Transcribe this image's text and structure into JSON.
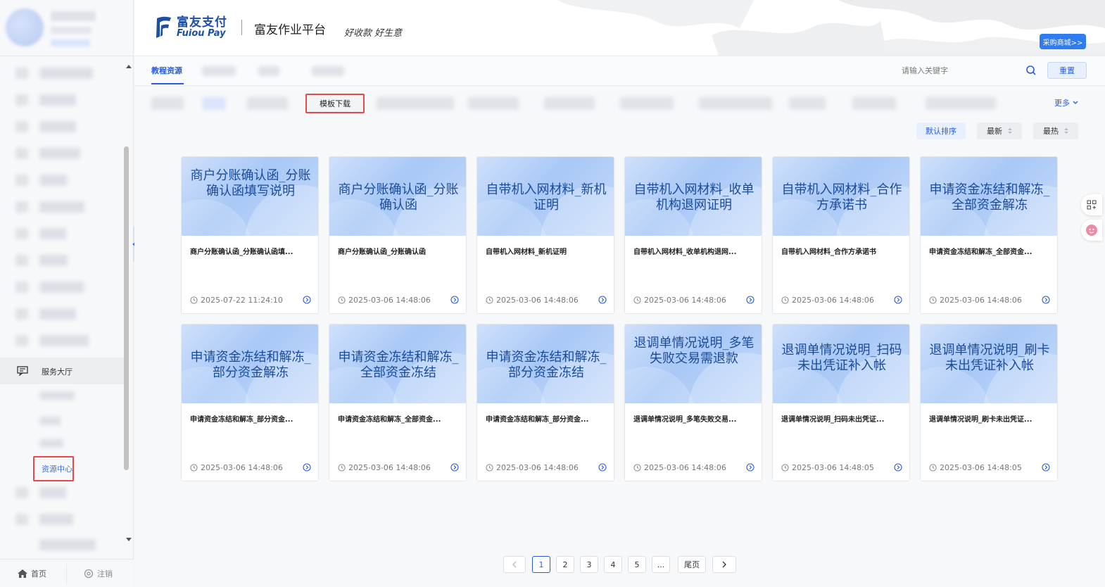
{
  "header": {
    "logo_cn": "富友支付",
    "logo_en": "Fuiou Pay",
    "title": "富友作业平台",
    "slogan": "好收款 好生意",
    "mall_button": "采购商城>>"
  },
  "sidebar": {
    "active_group_label": "服务大厅",
    "active_item_label": "资源中心",
    "bottom": {
      "home_label": "首页",
      "logout_label": "注销"
    }
  },
  "main": {
    "active_tab": "教程资源",
    "search": {
      "placeholder": "请输入关键字"
    },
    "reset_label": "重置",
    "highlight_category": "模板下载",
    "more_label": "更多",
    "sort": {
      "default": "默认排序",
      "newest": "最新",
      "hottest": "最热"
    }
  },
  "cards": [
    {
      "thumb": "商户分账确认函_分账确认函填写说明",
      "title": "商户分账确认函_分账确认函填...",
      "time": "2025-07-22 11:24:10"
    },
    {
      "thumb": "商户分账确认函_分账确认函",
      "title": "商户分账确认函_分账确认函",
      "time": "2025-03-06 14:48:06"
    },
    {
      "thumb": "自带机入网材料_新机证明",
      "title": "自带机入网材料_新机证明",
      "time": "2025-03-06 14:48:06"
    },
    {
      "thumb": "自带机入网材料_收单机构退网证明",
      "title": "自带机入网材料_收单机构退网...",
      "time": "2025-03-06 14:48:06"
    },
    {
      "thumb": "自带机入网材料_合作方承诺书",
      "title": "自带机入网材料_合作方承诺书",
      "time": "2025-03-06 14:48:06"
    },
    {
      "thumb": "申请资金冻结和解冻_全部资金解冻",
      "title": "申请资金冻结和解冻_全部资金...",
      "time": "2025-03-06 14:48:06"
    },
    {
      "thumb": "申请资金冻结和解冻_部分资金解冻",
      "title": "申请资金冻结和解冻_部分资金...",
      "time": "2025-03-06 14:48:06"
    },
    {
      "thumb": "申请资金冻结和解冻_全部资金冻结",
      "title": "申请资金冻结和解冻_全部资金...",
      "time": "2025-03-06 14:48:06"
    },
    {
      "thumb": "申请资金冻结和解冻_部分资金冻结",
      "title": "申请资金冻结和解冻_部分资金...",
      "time": "2025-03-06 14:48:06"
    },
    {
      "thumb": "退调单情况说明_多笔失败交易需退款",
      "title": "退调单情况说明_多笔失败交易...",
      "time": "2025-03-06 14:48:06"
    },
    {
      "thumb": "退调单情况说明_扫码未出凭证补入帐",
      "title": "退调单情况说明_扫码未出凭证...",
      "time": "2025-03-06 14:48:05"
    },
    {
      "thumb": "退调单情况说明_刷卡未出凭证补入帐",
      "title": "退调单情况说明_刷卡未出凭证...",
      "time": "2025-03-06 14:48:05"
    }
  ],
  "pagination": {
    "pages": [
      "1",
      "2",
      "3",
      "4",
      "5"
    ],
    "ellipsis": "...",
    "last_label": "尾页",
    "current": "1"
  },
  "colors": {
    "accent": "#2a5cd6",
    "highlight_border": "#e24b4b",
    "brand": "#1d4fa3"
  }
}
